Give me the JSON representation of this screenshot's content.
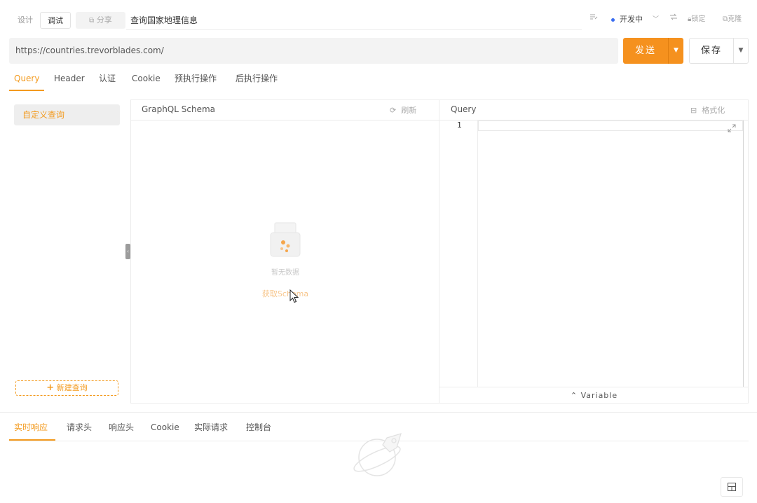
{
  "topbar": {
    "design_tab": "设计",
    "debug_tab": "调试",
    "share_btn": "分享",
    "request_name": "查询国家地理信息",
    "env_label": "开发中",
    "lock_label": "锁定",
    "clone_label": "克隆"
  },
  "url": {
    "value": "https://countries.trevorblades.com/",
    "send_label": "发送",
    "save_label": "保存"
  },
  "request_tabs": [
    "Query",
    "Header",
    "认证",
    "Cookie",
    "预执行操作",
    "后执行操作"
  ],
  "sidebar": {
    "items": [
      "自定义查询"
    ],
    "new_query": "新建查询"
  },
  "schema_pane": {
    "title": "GraphQL Schema",
    "refresh": "刷新",
    "empty_text": "暂无数据",
    "fetch_link": "获取Schema"
  },
  "query_pane": {
    "title": "Query",
    "format": "格式化",
    "line_numbers": [
      "1"
    ],
    "variable_bar": "Variable"
  },
  "response_tabs": [
    "实时响应",
    "请求头",
    "响应头",
    "Cookie",
    "实际请求",
    "控制台"
  ],
  "colors": {
    "accent": "#f5911e",
    "env_dot": "#3a6df0"
  }
}
